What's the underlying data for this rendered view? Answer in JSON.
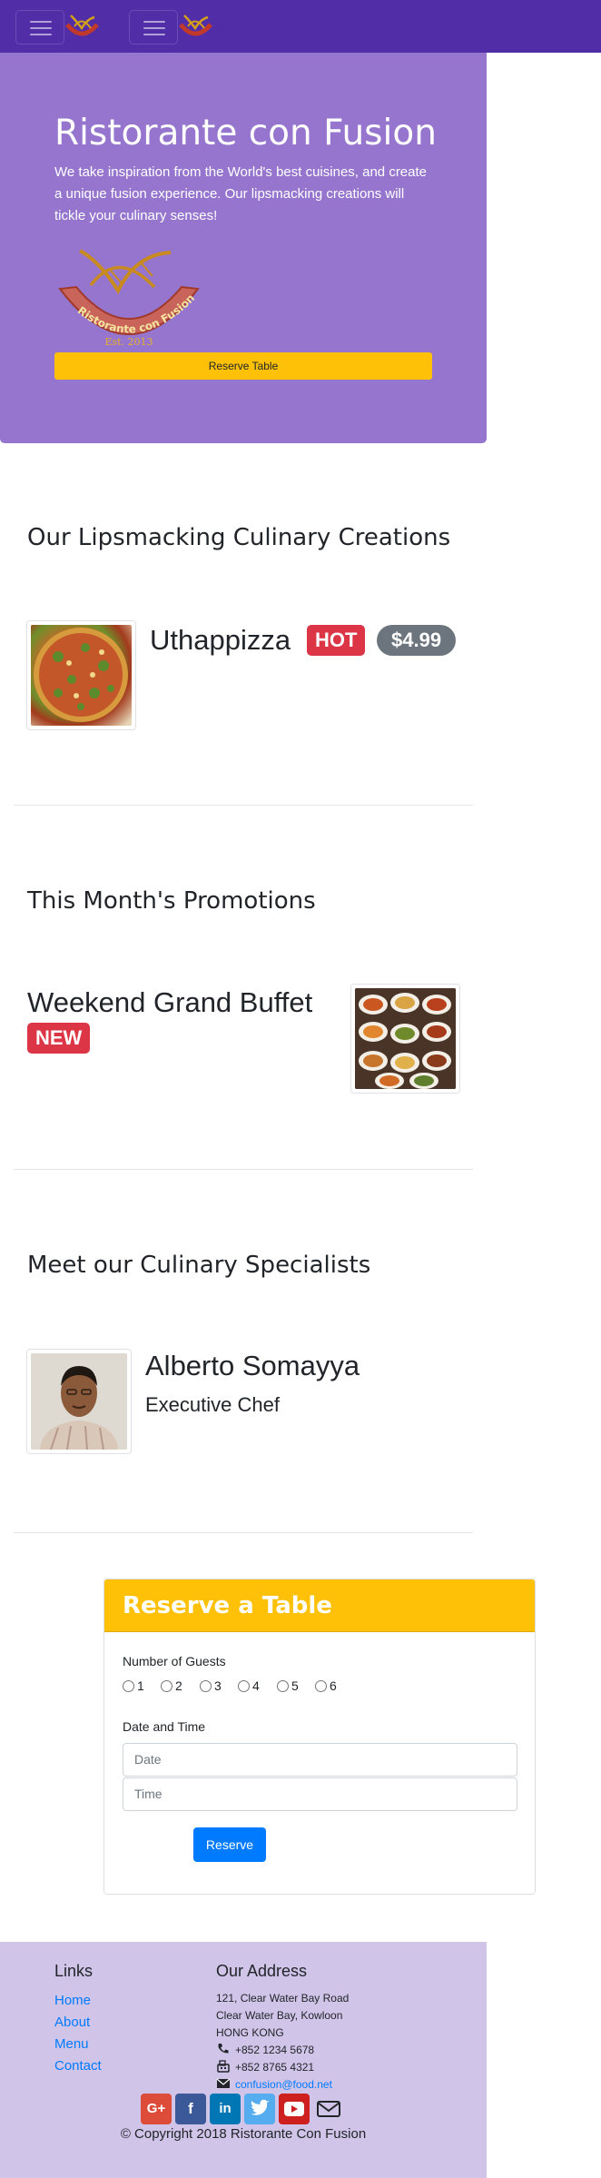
{
  "navbar": {
    "brand_logo_alt": "Ristorante Con Fusion"
  },
  "jumbotron": {
    "title": "Ristorante con Fusion",
    "text": "We take inspiration from the World's best cuisines, and create a unique fusion experience. Our lipsmacking creations will tickle your culinary senses!",
    "logo_text": "Ristorante con Fusion",
    "logo_est": "Est. 2013",
    "reserve_label": "Reserve Table"
  },
  "dish": {
    "heading": "Our Lipsmacking Culinary Creations",
    "name": "Uthappizza",
    "badge": "HOT",
    "price": "$4.99"
  },
  "promotion": {
    "heading": "This Month's Promotions",
    "name": "Weekend Grand Buffet",
    "badge": "NEW"
  },
  "specialist": {
    "heading": "Meet our Culinary Specialists",
    "name": "Alberto Somayya",
    "title": "Executive Chef"
  },
  "reserve_form": {
    "title": "Reserve a Table",
    "guests_label": "Number of Guests",
    "guest_options": [
      "1",
      "2",
      "3",
      "4",
      "5",
      "6"
    ],
    "datetime_label": "Date and Time",
    "date_placeholder": "Date",
    "time_placeholder": "Time",
    "submit_label": "Reserve"
  },
  "footer": {
    "links_heading": "Links",
    "links": [
      "Home",
      "About",
      "Menu",
      "Contact"
    ],
    "address_heading": "Our Address",
    "address_lines": [
      "121, Clear Water Bay Road",
      "Clear Water Bay, Kowloon",
      "HONG KONG"
    ],
    "phone": "+852 1234 5678",
    "fax": "+852 8765 4321",
    "email": "confusion@food.net",
    "copyright": "© Copyright 2018 Ristorante Con Fusion"
  },
  "colors": {
    "navbar": "#512DA8",
    "jumbotron": "#9575CD",
    "footer": "#D1C4E9",
    "warning": "#FFC107",
    "danger": "#dc3545",
    "primary": "#007bff"
  },
  "icons": [
    "menu-icon",
    "phone-icon",
    "fax-icon",
    "envelope-icon",
    "google-plus-icon",
    "facebook-icon",
    "linkedin-icon",
    "twitter-icon",
    "youtube-icon",
    "mail-icon"
  ]
}
